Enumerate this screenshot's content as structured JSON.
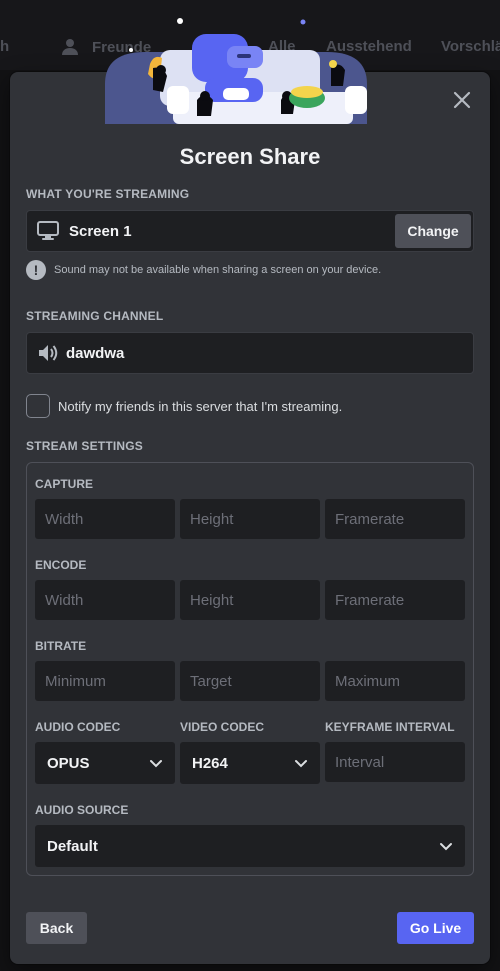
{
  "background": {
    "nav_fragments": [
      "h",
      "Freunde",
      "Alle",
      "Ausstehend",
      "Vorschlä"
    ]
  },
  "modal": {
    "title": "Screen Share",
    "close_icon": "close-icon",
    "streaming": {
      "label": "WHAT YOU'RE STREAMING",
      "source": "Screen 1",
      "source_icon": "monitor-icon",
      "change_label": "Change",
      "notice": "Sound may not be available when sharing a screen on your device."
    },
    "channel": {
      "label": "STREAMING CHANNEL",
      "name": "dawdwa",
      "icon": "speaker-icon"
    },
    "notify_label": "Notify my friends in this server that I'm streaming.",
    "notify_checked": false,
    "settings": {
      "label": "STREAM SETTINGS",
      "capture": {
        "label": "CAPTURE",
        "width_placeholder": "Width",
        "height_placeholder": "Height",
        "framerate_placeholder": "Framerate"
      },
      "encode": {
        "label": "ENCODE",
        "width_placeholder": "Width",
        "height_placeholder": "Height",
        "framerate_placeholder": "Framerate"
      },
      "bitrate": {
        "label": "BITRATE",
        "minimum_placeholder": "Minimum",
        "target_placeholder": "Target",
        "maximum_placeholder": "Maximum"
      },
      "audio_codec": {
        "label": "AUDIO CODEC",
        "value": "OPUS"
      },
      "video_codec": {
        "label": "VIDEO CODEC",
        "value": "H264"
      },
      "keyframe": {
        "label": "KEYFRAME INTERVAL",
        "placeholder": "Interval"
      },
      "audio_source": {
        "label": "AUDIO SOURCE",
        "value": "Default"
      }
    },
    "back_label": "Back",
    "golive_label": "Go Live",
    "colors": {
      "modal_bg": "#313338",
      "input_bg": "#1e1f22",
      "accent": "#5865f2",
      "secondary_btn": "#4e5058"
    }
  }
}
